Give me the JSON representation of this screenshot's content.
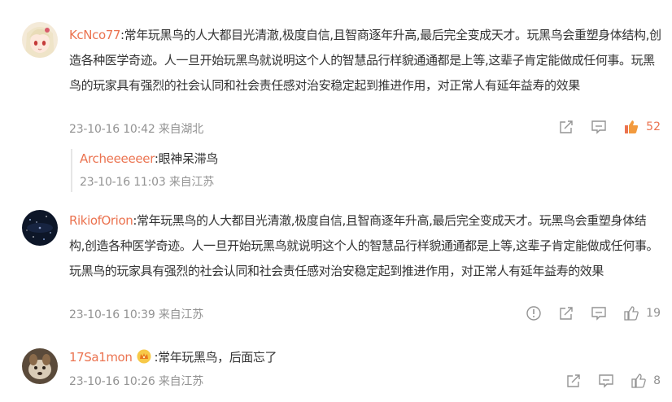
{
  "comments": [
    {
      "username": "KcNco77",
      "text": ":常年玩黑鸟的人大都目光清澈,极度自信,且智商逐年升高,最后完全变成天才。玩黑鸟会重塑身体结构,创造各种医学奇迹。人一旦开始玩黑鸟就说明这个人的智慧品行样貌通通都是上等,这辈子肯定能做成任何事。玩黑鸟的玩家具有强烈的社会认同和社会责任感对治安稳定起到推进作用，对正常人有延年益寿的效果",
      "time": "23-10-16 10:42",
      "location": "来自湖北",
      "likes": "52",
      "liked": true,
      "replies": [
        {
          "username": "Archeeeeeer",
          "text": ":眼神呆滞鸟",
          "time": "23-10-16 11:03",
          "location": "来自江苏"
        }
      ]
    },
    {
      "username": "RikiofOrion",
      "text": ":常年玩黑鸟的人大都目光清澈,极度自信,且智商逐年升高,最后完全变成天才。玩黑鸟会重塑身体结构,创造各种医学奇迹。人一旦开始玩黑鸟就说明这个人的智慧品行样貌通通都是上等,这辈子肯定能做成任何事。玩黑鸟的玩家具有强烈的社会认同和社会责任感对治安稳定起到推进作用，对正常人有延年益寿的效果",
      "time": "23-10-16 10:39",
      "location": "来自江苏",
      "likes": "19",
      "liked": false
    },
    {
      "username": "17Sa1mon",
      "text": ":常年玩黑鸟，后面忘了",
      "time": "23-10-16 10:26",
      "location": "来自江苏",
      "likes": "8",
      "liked": false
    }
  ],
  "colors": {
    "accent": "#eb7350",
    "meta": "#939393",
    "text": "#333333"
  },
  "icons": [
    "report-icon",
    "share-icon",
    "comment-icon",
    "thumbs-up-icon",
    "crown-badge-icon"
  ]
}
